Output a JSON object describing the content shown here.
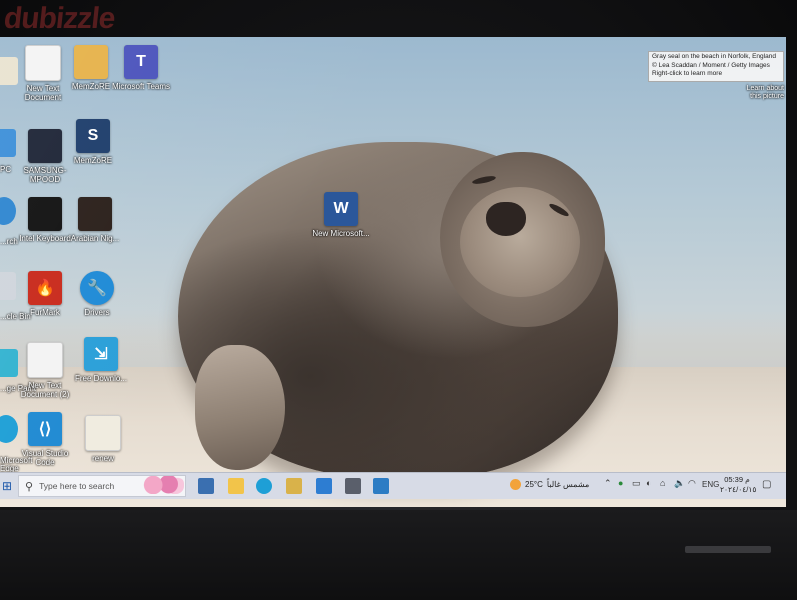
{
  "watermark": "dubizzle",
  "bing": {
    "tooltip_lines": [
      "Gray seal on the beach in Norfolk, England",
      "© Lea Scaddan / Moment / Getty Images",
      "Right-click to learn more"
    ],
    "learn_more": "Learn about this picture"
  },
  "desktop_icons": [
    {
      "label": "New Text Document"
    },
    {
      "label": "MemZoRE"
    },
    {
      "label": "Microsoft Teams",
      "glyph": "T"
    },
    {
      "label": "SAMSUNG-MPOOD"
    },
    {
      "label": "MemZoRE",
      "glyph": "S"
    },
    {
      "label": "Intel Keyboard"
    },
    {
      "label": "Arabian Nig..."
    },
    {
      "label": "FurMark"
    },
    {
      "label": "Drivers"
    },
    {
      "label": "New Text Document (2)"
    },
    {
      "label": "Free Downlo..."
    },
    {
      "label": "Visual Studio Code"
    },
    {
      "label": "renew"
    },
    {
      "label": "New Microsoft...",
      "glyph": "W"
    }
  ],
  "edge_labels": [
    "PC",
    "...rch",
    "...cle Bin",
    "...ge Paint",
    "Microsoft Edge"
  ],
  "taskbar": {
    "search_placeholder": "Type here to search",
    "weather_temp": "25°C",
    "weather_desc": "مشمس غالباً",
    "language": "ENG",
    "time": "05:39 م",
    "date": "٢٠٢٤/٠٤/١٥"
  },
  "colors": {
    "taskbar": "#d7dbe6",
    "teams": "#4b53bc",
    "word": "#2b579a",
    "vscode": "#1f8ad2",
    "edge": "#1e9fd6"
  }
}
